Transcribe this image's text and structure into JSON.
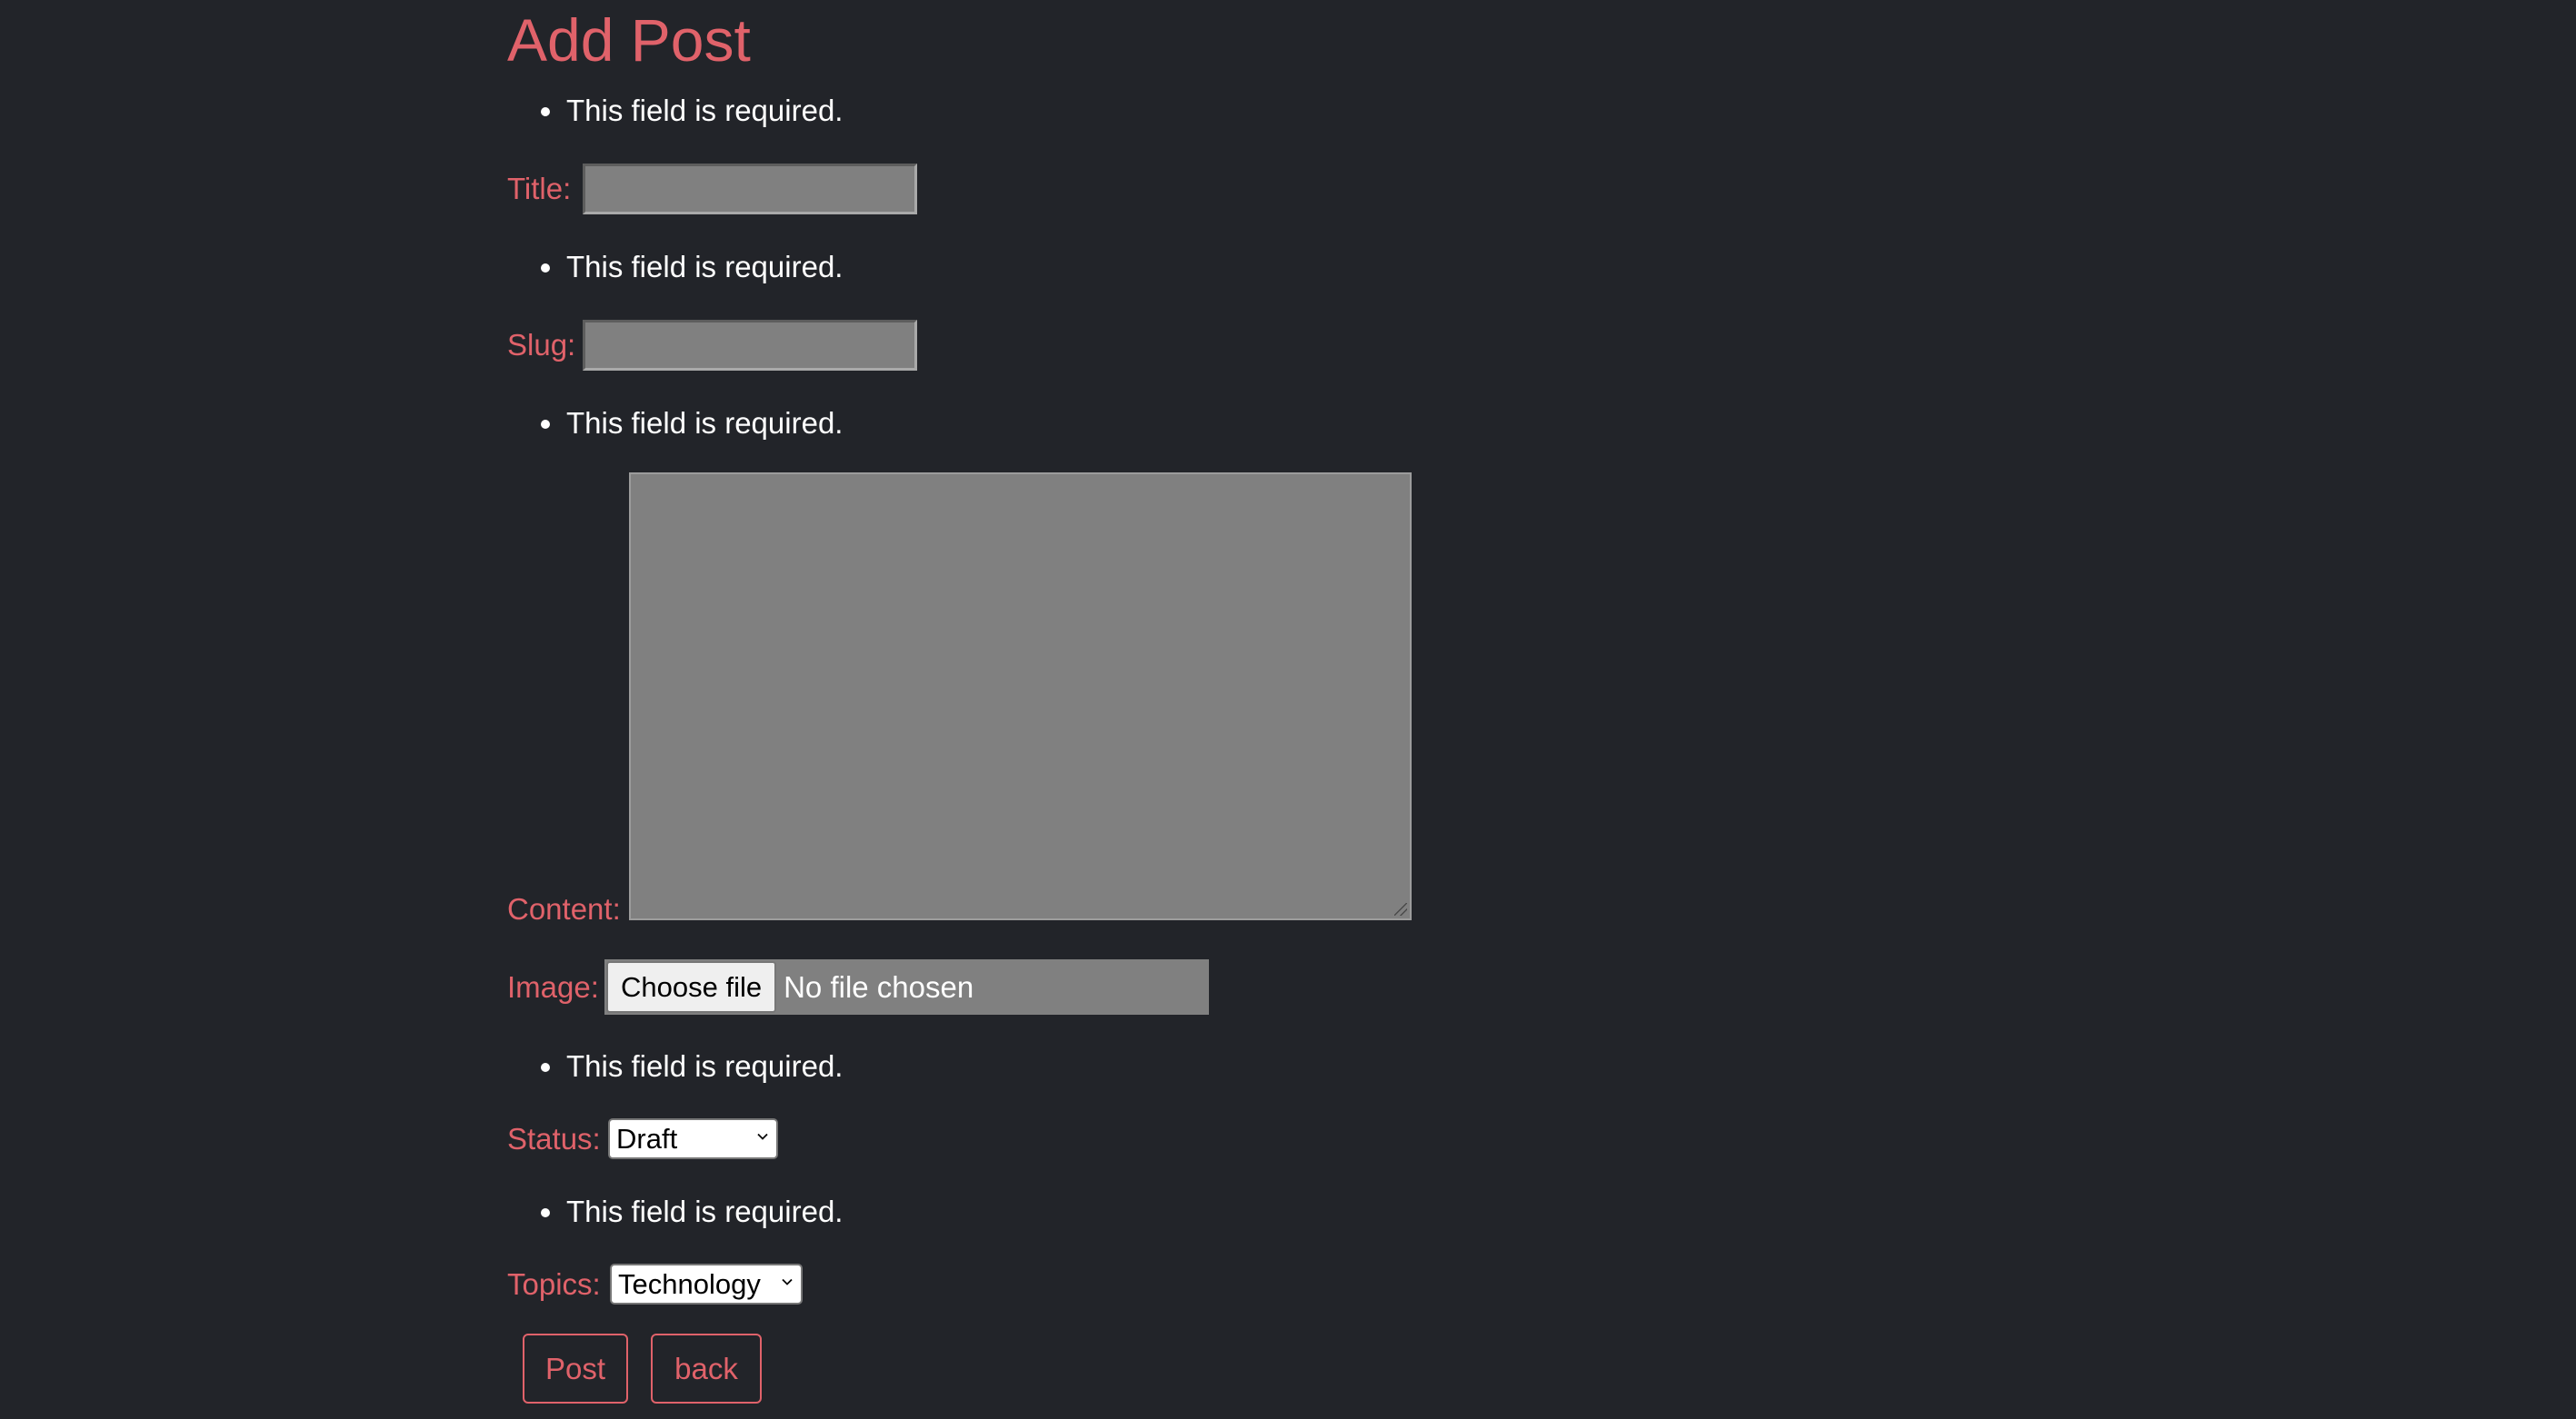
{
  "page": {
    "heading": "Add Post"
  },
  "form": {
    "title": {
      "error": "This field is required.",
      "label": "Title:",
      "value": ""
    },
    "slug": {
      "error": "This field is required.",
      "label": "Slug:",
      "value": ""
    },
    "content": {
      "error": "This field is required.",
      "label": "Content:",
      "value": ""
    },
    "image": {
      "label": "Image:",
      "button_label": "Choose file",
      "status": "No file chosen"
    },
    "status": {
      "error": "This field is required.",
      "label": "Status:",
      "selected": "Draft"
    },
    "topics": {
      "error": "This field is required.",
      "label": "Topics:",
      "selected": "Technology"
    }
  },
  "actions": {
    "post_label": "Post",
    "back_label": "back"
  },
  "colors": {
    "background": "#222429",
    "accent": "#e0626a",
    "input_fill": "#808080",
    "text": "#ffffff"
  },
  "icons": {
    "select_chevron": "chevron-down-icon",
    "bullet": "bullet-icon"
  }
}
